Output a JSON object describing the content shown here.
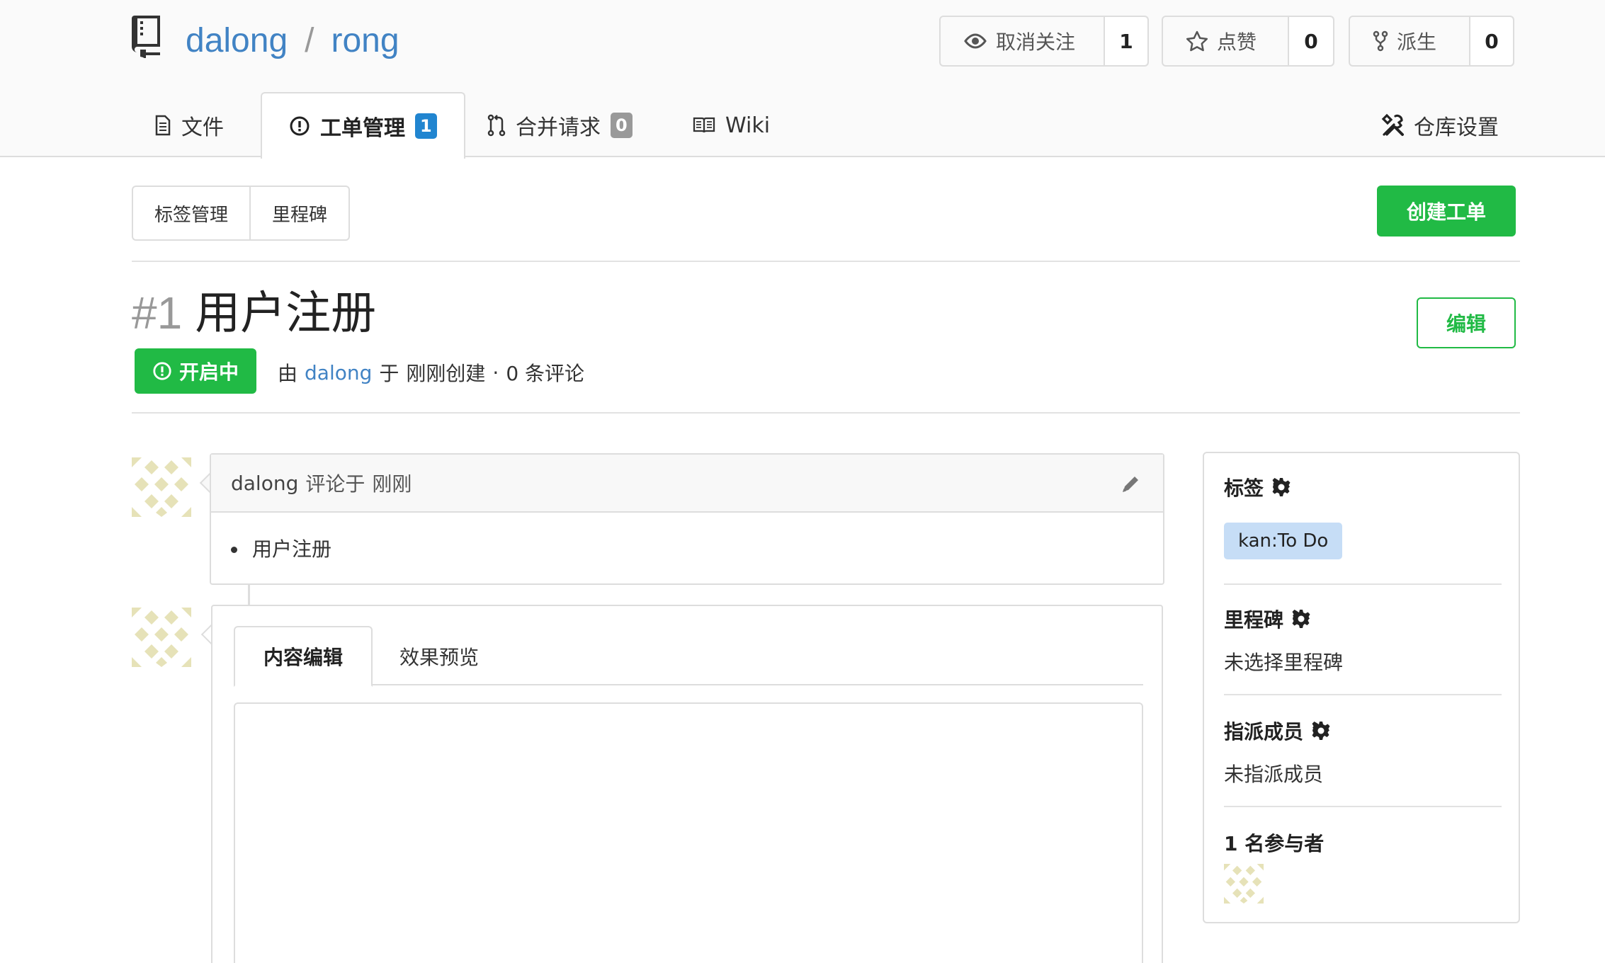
{
  "repo": {
    "owner": "dalong",
    "separator": "/",
    "name": "rong"
  },
  "actions": {
    "watch": {
      "label": "取消关注",
      "count": "1",
      "icon": "eye-icon"
    },
    "star": {
      "label": "点赞",
      "count": "0",
      "icon": "star-icon"
    },
    "fork": {
      "label": "派生",
      "count": "0",
      "icon": "fork-icon"
    }
  },
  "tabs": {
    "files": {
      "label": "文件",
      "icon": "file-icon"
    },
    "issues": {
      "label": "工单管理",
      "count": "1",
      "icon": "issue-opened-icon"
    },
    "pulls": {
      "label": "合并请求",
      "count": "0",
      "icon": "pull-request-icon"
    },
    "wiki": {
      "label": "Wiki",
      "icon": "book-icon"
    },
    "settings": {
      "label": "仓库设置",
      "icon": "tools-icon"
    }
  },
  "toolbar": {
    "labels": "标签管理",
    "milestones": "里程碑",
    "create": "创建工单"
  },
  "issue": {
    "index": "#1",
    "title": "用户注册",
    "edit": "编辑",
    "status": "开启中",
    "meta": {
      "by": "由",
      "author": "dalong",
      "at": "于",
      "time": "刚刚创建",
      "dot": "·",
      "comments": "0 条评论"
    }
  },
  "comment": {
    "author": "dalong",
    "action": "评论于",
    "time": "刚刚",
    "items": [
      "用户注册"
    ]
  },
  "editor": {
    "tab_write": "内容编辑",
    "tab_preview": "效果预览"
  },
  "sidebar": {
    "labels": {
      "title": "标签",
      "label": "kan:To Do",
      "label_color": "#c6ddf6"
    },
    "milestone": {
      "title": "里程碑",
      "value": "未选择里程碑"
    },
    "assignees": {
      "title": "指派成员",
      "value": "未指派成员"
    },
    "participants": {
      "title": "1 名参与者"
    }
  },
  "colors": {
    "accent": "#4183c4",
    "success": "#21ba45",
    "badge_blue": "#2185d0",
    "badge_grey": "#999999",
    "avatar": "#e6e2b8"
  }
}
